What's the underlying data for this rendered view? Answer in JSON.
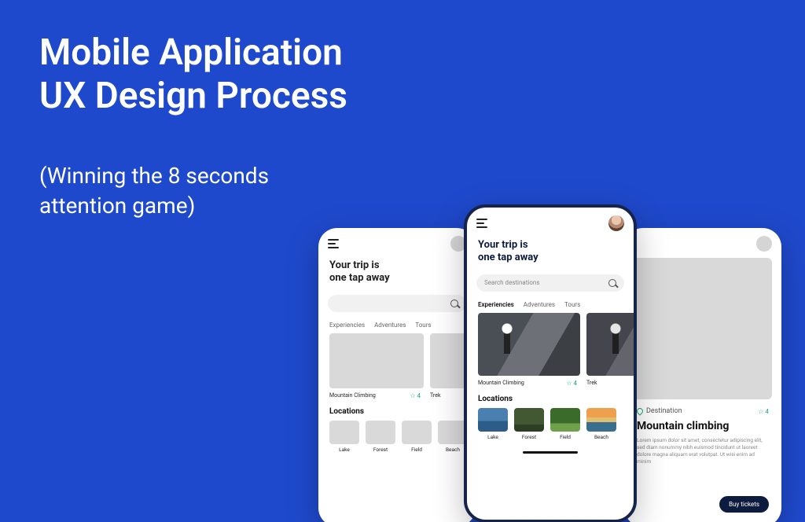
{
  "headline_l1": "Mobile Application",
  "headline_l2": "UX Design Process",
  "sub_l1": "(Winning the 8 seconds",
  "sub_l2": "attention game)",
  "shared": {
    "title_l1": "Your trip is",
    "title_l2": "one tap away",
    "search_placeholder": "Search destinations",
    "tabs": [
      "Experiencies",
      "Adventures",
      "Tours"
    ],
    "card1_title": "Mountain Climbing",
    "card2_title": "Trek",
    "rating": "4",
    "locations_label": "Locations",
    "locs": [
      "Lake",
      "Forest",
      "Field",
      "Beach"
    ]
  },
  "detail": {
    "destination_label": "Destination",
    "rating": "4",
    "title": "Mountain climbing",
    "lorem": "Lorem ipsum dolor sit amet, consectetur adipiscing elit, sed diam nonummy nibh euismod tincidunt ut laoreet dolore magna aliquam erat volutpat. Ut wisi enim ad minim",
    "cta": "Buy tickets"
  }
}
